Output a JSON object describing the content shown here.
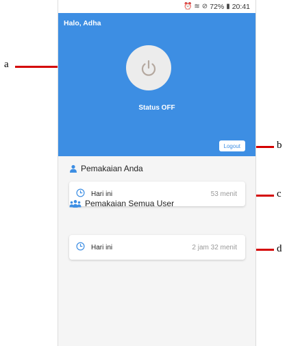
{
  "status_bar": {
    "battery": "72%",
    "time": "20:41"
  },
  "header": {
    "greeting": "Halo, Adha",
    "power_status": "Status OFF",
    "logout_label": "Logout"
  },
  "sections": [
    {
      "title": "Pemakaian Anda",
      "card": {
        "label": "Hari ini",
        "value": "53 menit"
      }
    },
    {
      "title": "Pemakaian Semua User",
      "card": {
        "label": "Hari ini",
        "value": "2 jam 32 menit"
      }
    }
  ],
  "annotations": {
    "a": "a",
    "b": "b",
    "c": "c",
    "d": "d"
  },
  "colors": {
    "header": "#3d8ee3",
    "arrow": "#d40000",
    "icon": "#3d8ee3"
  }
}
